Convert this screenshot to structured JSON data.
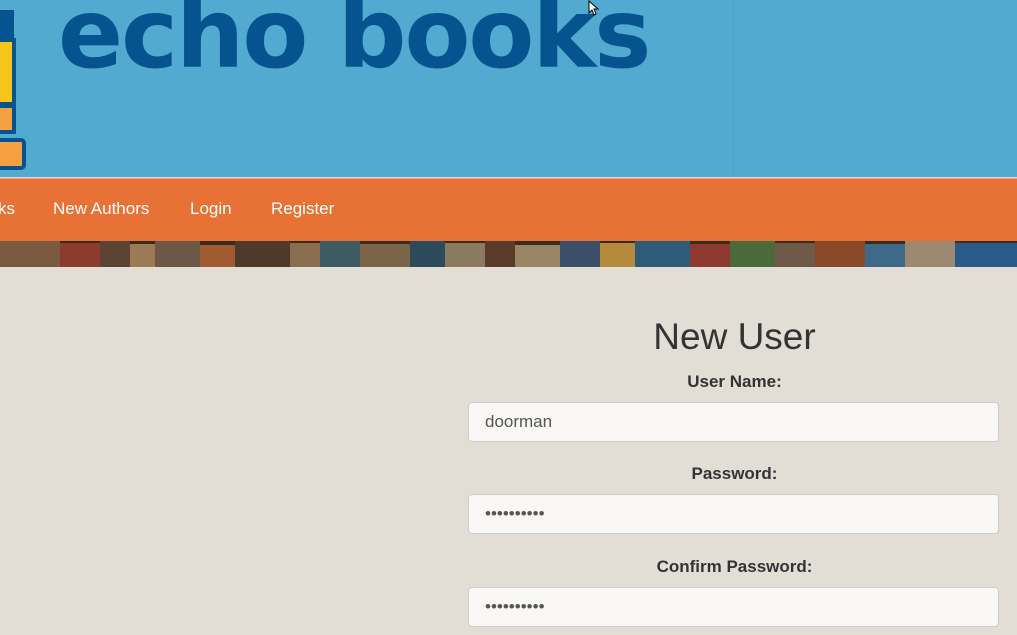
{
  "header": {
    "logo_text": "echo books",
    "colors": {
      "background": "#52aad1",
      "logo": "#06548f",
      "logo_accent": "#f5a142",
      "logo_yellow": "#f5c518"
    }
  },
  "nav": {
    "items": [
      {
        "label": "ks"
      },
      {
        "label": "New Authors"
      },
      {
        "label": "Login"
      },
      {
        "label": "Register"
      }
    ],
    "color": "#e87236"
  },
  "form": {
    "title": "New User",
    "username": {
      "label": "User Name:",
      "value": "doorman"
    },
    "password": {
      "label": "Password:",
      "value": "••••••••••"
    },
    "confirm_password": {
      "label": "Confirm Password:",
      "value": "••••••••••"
    }
  }
}
